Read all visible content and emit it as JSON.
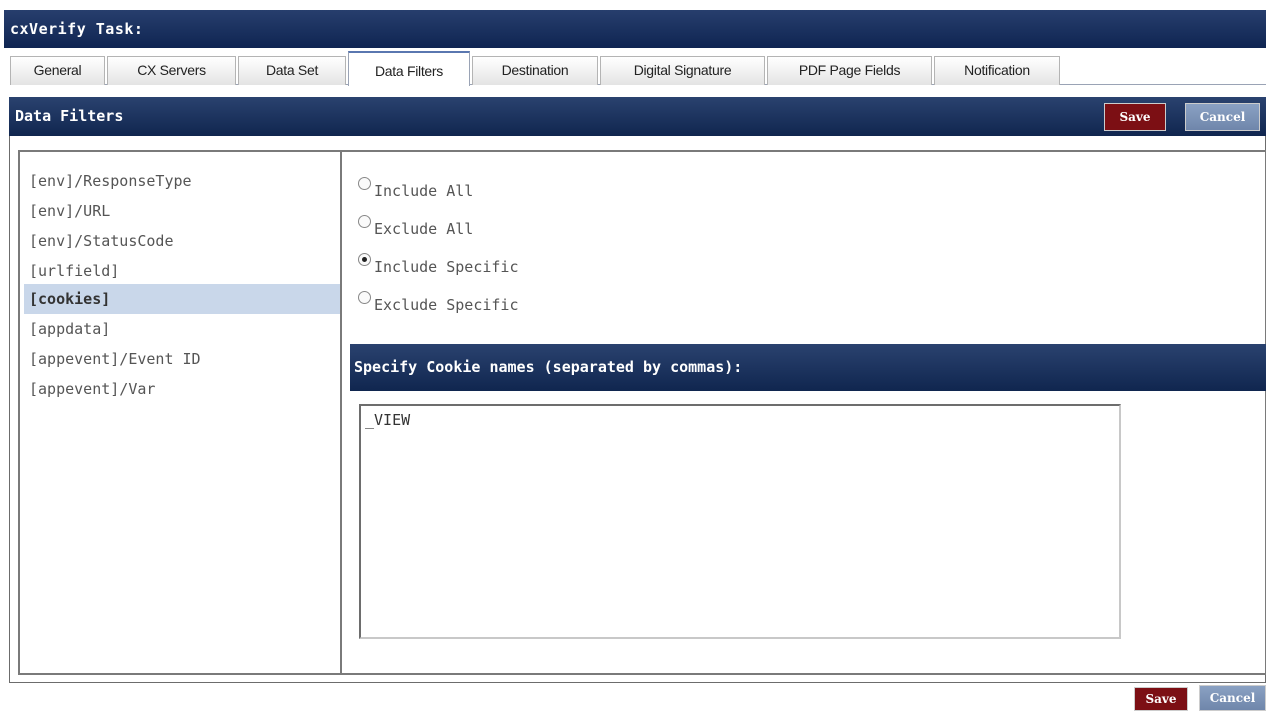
{
  "window": {
    "title": "cxVerify Task:"
  },
  "tabs": [
    {
      "label": "General"
    },
    {
      "label": "CX Servers"
    },
    {
      "label": "Data Set"
    },
    {
      "label": "Data Filters",
      "active": true
    },
    {
      "label": "Destination"
    },
    {
      "label": "Digital Signature"
    },
    {
      "label": "PDF Page Fields"
    },
    {
      "label": "Notification"
    }
  ],
  "panel": {
    "title": "Data Filters",
    "save_label": "Save",
    "cancel_label": "Cancel"
  },
  "fields": [
    {
      "label": "[env]/ResponseType"
    },
    {
      "label": "[env]/URL"
    },
    {
      "label": "[env]/StatusCode"
    },
    {
      "label": "[urlfield]"
    },
    {
      "label": "[cookies]",
      "selected": true
    },
    {
      "label": "[appdata]"
    },
    {
      "label": "[appevent]/Event ID"
    },
    {
      "label": "[appevent]/Var"
    }
  ],
  "filter_options": [
    {
      "label": "Include All",
      "checked": false
    },
    {
      "label": "Exclude All",
      "checked": false
    },
    {
      "label": "Include Specific",
      "checked": true
    },
    {
      "label": "Exclude Specific",
      "checked": false
    }
  ],
  "specify": {
    "heading": "Specify Cookie names (separated by commas):",
    "value": "_VIEW"
  },
  "footer": {
    "save_label": "Save",
    "cancel_label": "Cancel"
  },
  "colors": {
    "header_navy": "#10264f",
    "save_red": "#7c0f14",
    "cancel_blue": "#7b93b8",
    "selected_row": "#c9d7ea"
  }
}
